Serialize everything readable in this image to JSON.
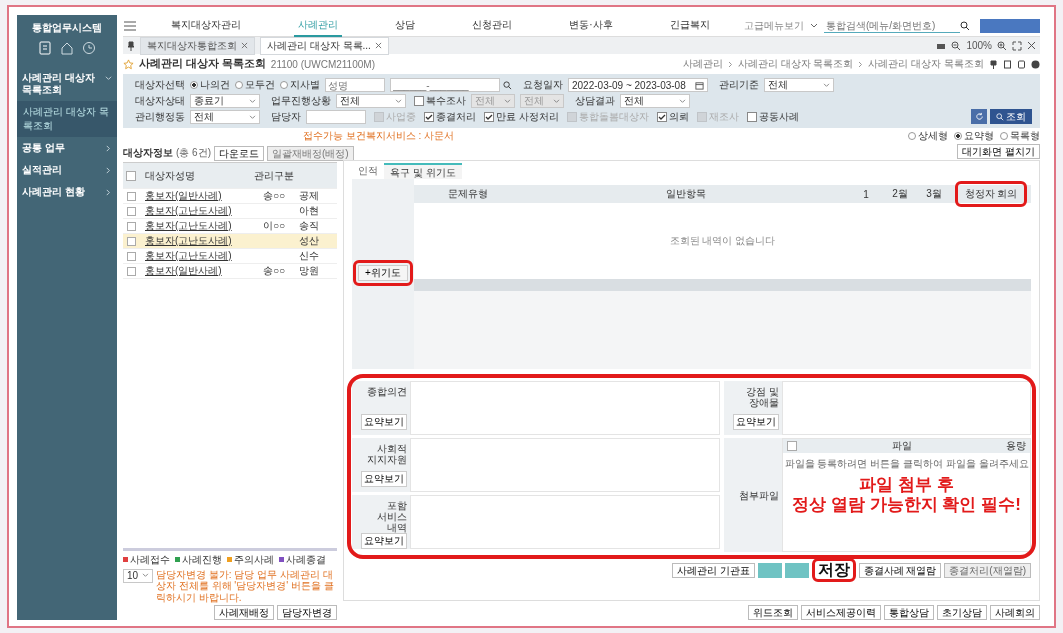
{
  "sidebar": {
    "title": "통합업무시스템",
    "items": [
      {
        "label": "사례관리 대상자 목록조회",
        "expanded": true,
        "children": [
          {
            "label": "사례관리 대상자 목록조회",
            "selected": true
          }
        ]
      },
      {
        "label": "공통 업무",
        "expanded": false
      },
      {
        "label": "실적관리",
        "expanded": false
      },
      {
        "label": "사례관리 현황",
        "expanded": false
      }
    ]
  },
  "top_nav": {
    "items": [
      {
        "label": "복지대상자관리",
        "selected": false
      },
      {
        "label": "사례관리",
        "selected": true
      },
      {
        "label": "상담",
        "selected": false
      },
      {
        "label": "신청관리",
        "selected": false
      },
      {
        "label": "변동·사후",
        "selected": false
      },
      {
        "label": "긴급복지",
        "selected": false
      }
    ],
    "menu_toggle": "고급메뉴보기",
    "search": {
      "placeholder": "통합검색(메뉴/화면번호)"
    }
  },
  "tabs": [
    {
      "label": "복지대상자통합조회",
      "selected": false
    },
    {
      "label": "사례관리 대상자 목록...",
      "selected": true
    }
  ],
  "zoom_level": "100%",
  "page": {
    "title": "사례관리 대상자 목록조회",
    "code": "21100 (UWCM21100M)",
    "breadcrumb": [
      "사례관리",
      "사례관리 대상자 목록조회",
      "사례관리 대상자 목록조회"
    ]
  },
  "filters": {
    "lines": [
      {
        "fields": [
          {
            "kind": "radio",
            "label": "대상자선택",
            "options": [
              {
                "label": "나의건",
                "selected": true
              },
              {
                "label": "모두건",
                "selected": false
              },
              {
                "label": "지사별",
                "selected": false
              }
            ]
          },
          {
            "kind": "input",
            "placeholder": "성명"
          },
          {
            "kind": "search",
            "placeholder": "______-_______"
          },
          {
            "kind": "date",
            "label": "요청일자",
            "value": "2022-03-09 ~ 2023-03-08"
          },
          {
            "kind": "select",
            "label": "관리기준",
            "value": "전체"
          }
        ]
      },
      {
        "fields": [
          {
            "kind": "select",
            "label": "대상자상태",
            "value": "종료기"
          },
          {
            "kind": "select",
            "label": "업무진행상황",
            "value": "전체"
          },
          {
            "kind": "checkbox",
            "label": "복수조사",
            "checked": false,
            "disabled": false
          },
          {
            "kind": "select",
            "value": "전체",
            "disabled": true
          },
          {
            "kind": "select",
            "value": "전체",
            "disabled": true
          },
          {
            "kind": "select",
            "label": "상담결과",
            "value": "전체"
          }
        ]
      },
      {
        "fields": [
          {
            "kind": "select",
            "label": "관리행정동",
            "value": "전체"
          },
          {
            "kind": "input",
            "label": "담당자"
          },
          {
            "kind": "checkbox",
            "label": "사업중",
            "checked": false,
            "disabled": true
          },
          {
            "kind": "checkbox",
            "label": "종결처리",
            "checked": true,
            "disabled": false
          },
          {
            "kind": "checkbox",
            "label": "만료 사정처리",
            "checked": true,
            "disabled": false
          },
          {
            "kind": "checkbox",
            "label": "통합돌봄대상자",
            "checked": false,
            "disabled": true
          },
          {
            "kind": "checkbox",
            "label": "의뢰",
            "checked": true,
            "disabled": false
          },
          {
            "kind": "checkbox",
            "label": "재조사",
            "checked": false,
            "disabled": true
          },
          {
            "kind": "checkbox",
            "label": "공동사례",
            "checked": false,
            "disabled": false
          }
        ]
      }
    ],
    "search_button": "조회"
  },
  "notice": "접수가능 보건복지서비스 : 사문서",
  "view_options": [
    {
      "label": "상세형",
      "selected": false
    },
    {
      "label": "요약형",
      "selected": true
    },
    {
      "label": "목록형",
      "selected": false
    }
  ],
  "expand_button": "대기화면 펼치기",
  "list": {
    "title": "대상자정보",
    "count": "(총 6건)",
    "buttons": [
      "다운로드",
      "일괄재배정(배정)"
    ],
    "all_checked": false,
    "columns": [
      "대상자성명",
      "관리구분"
    ],
    "rows": [
      {
        "name": "홍보자(일반사례)",
        "manager": "송○○",
        "column_3": "공제",
        "selected": false
      },
      {
        "name": "홍보자(고난도사례)",
        "manager": "",
        "column_3": "아현",
        "selected": false
      },
      {
        "name": "홍보자(고난도사례)",
        "manager": "이○○",
        "column_3": "송직",
        "selected": false
      },
      {
        "name": "홍보자(고난도사례)",
        "manager": "",
        "column_3": "성산",
        "selected": true
      },
      {
        "name": "홍보자(고난도사례)",
        "manager": "",
        "column_3": "신수",
        "selected": false
      },
      {
        "name": "홍보자(일반사례)",
        "manager": "송○○",
        "column_3": "망원",
        "selected": false
      }
    ],
    "legend": [
      {
        "label": "사례접수",
        "color": "#e04040"
      },
      {
        "label": "사례진행",
        "color": "#30a050"
      },
      {
        "label": "주의사례",
        "color": "#f0a020"
      },
      {
        "label": "사례종결",
        "color": "#8050c0"
      }
    ],
    "page_size": "10",
    "warning": "담당자변경 불가: 담당 업무 사례관리 대상자 전체를 위해 '담당자변경' 버튼을 클릭하시기 바랍니다.",
    "footer_buttons": [
      "사례재배정",
      "담당자변경"
    ]
  },
  "detail": {
    "tabs": [
      {
        "label": "인적",
        "selected": false
      },
      {
        "label": "욕구 및 위기도",
        "selected": true
      }
    ],
    "columns": [
      "문제유형",
      "일반항목",
      "1",
      "2월",
      "3월",
      "청정자 회의"
    ],
    "empty_message": "조회된 내역이 없습니다",
    "add_button": "+위기도",
    "form_left": [
      {
        "label": "종합의견",
        "button": "요약보기"
      },
      {
        "label": "사회적 지지자원",
        "button": "요약보기"
      },
      {
        "label": "포함 서비스 내역",
        "button": "요약보기"
      }
    ],
    "form_right": {
      "label": "강점 및 장애물",
      "button": "요약보기",
      "attach_label": "첨부파일",
      "attach_all_checked": false,
      "attach_columns": [
        "파일",
        "용량"
      ],
      "attach_hint": "파일을 등록하려면 버튼을 클릭하여 파일을 올려주세요"
    },
    "buttons": [
      {
        "label": "사례관리 기관표",
        "kind": "plain"
      },
      {
        "kind": "primary"
      },
      {
        "kind": "primary"
      },
      {
        "kind": "save_callout"
      },
      {
        "label": "종결사례 재열람",
        "kind": "plain"
      },
      {
        "label": "종결처리(재열람)",
        "kind": "muted"
      }
    ]
  },
  "bottom_buttons": [
    "위드조회",
    "서비스제공이력",
    "통합상담",
    "초기상담",
    "사례회의"
  ],
  "annotation": {
    "callout": [
      "파일 첨부 후",
      "정상 열람 가능한지 확인 필수!"
    ],
    "save_label": "저장"
  }
}
